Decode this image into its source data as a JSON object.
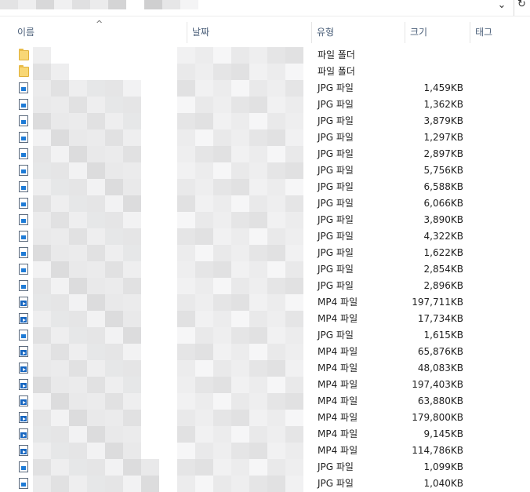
{
  "toolbar": {
    "dropdown_glyph": "⌄",
    "refresh_glyph": "↻"
  },
  "columns": {
    "name": "이름",
    "date": "날짜",
    "type": "유형",
    "size": "크기",
    "tags": "태그",
    "sort_indicator": "^"
  },
  "files": [
    {
      "icon": "folder-icon",
      "type": "파일 폴더",
      "size": ""
    },
    {
      "icon": "folder-icon",
      "type": "파일 폴더",
      "size": ""
    },
    {
      "icon": "image-file-icon",
      "type": "JPG 파일",
      "size": "1,459KB"
    },
    {
      "icon": "image-file-icon",
      "type": "JPG 파일",
      "size": "1,362KB"
    },
    {
      "icon": "image-file-icon",
      "type": "JPG 파일",
      "size": "3,879KB"
    },
    {
      "icon": "image-file-icon",
      "type": "JPG 파일",
      "size": "1,297KB"
    },
    {
      "icon": "image-file-icon",
      "type": "JPG 파일",
      "size": "2,897KB"
    },
    {
      "icon": "image-file-icon",
      "type": "JPG 파일",
      "size": "5,756KB"
    },
    {
      "icon": "image-file-icon",
      "type": "JPG 파일",
      "size": "6,588KB"
    },
    {
      "icon": "image-file-icon",
      "type": "JPG 파일",
      "size": "6,066KB"
    },
    {
      "icon": "image-file-icon",
      "type": "JPG 파일",
      "size": "3,890KB"
    },
    {
      "icon": "image-file-icon",
      "type": "JPG 파일",
      "size": "4,322KB"
    },
    {
      "icon": "image-file-icon",
      "type": "JPG 파일",
      "size": "1,622KB"
    },
    {
      "icon": "image-file-icon",
      "type": "JPG 파일",
      "size": "2,854KB"
    },
    {
      "icon": "image-file-icon",
      "type": "JPG 파일",
      "size": "2,896KB"
    },
    {
      "icon": "video-file-icon",
      "type": "MP4 파일",
      "size": "197,711KB"
    },
    {
      "icon": "video-file-icon",
      "type": "MP4 파일",
      "size": "17,734KB"
    },
    {
      "icon": "image-file-icon",
      "type": "JPG 파일",
      "size": "1,615KB"
    },
    {
      "icon": "video-file-icon",
      "type": "MP4 파일",
      "size": "65,876KB"
    },
    {
      "icon": "video-file-icon",
      "type": "MP4 파일",
      "size": "48,083KB"
    },
    {
      "icon": "video-file-icon",
      "type": "MP4 파일",
      "size": "197,403KB"
    },
    {
      "icon": "video-file-icon",
      "type": "MP4 파일",
      "size": "63,880KB"
    },
    {
      "icon": "video-file-icon",
      "type": "MP4 파일",
      "size": "179,800KB"
    },
    {
      "icon": "video-file-icon",
      "type": "MP4 파일",
      "size": "9,145KB"
    },
    {
      "icon": "video-file-icon",
      "type": "MP4 파일",
      "size": "114,786KB"
    },
    {
      "icon": "image-file-icon",
      "type": "JPG 파일",
      "size": "1,099KB"
    },
    {
      "icon": "image-file-icon",
      "type": "JPG 파일",
      "size": "1,040KB"
    }
  ]
}
